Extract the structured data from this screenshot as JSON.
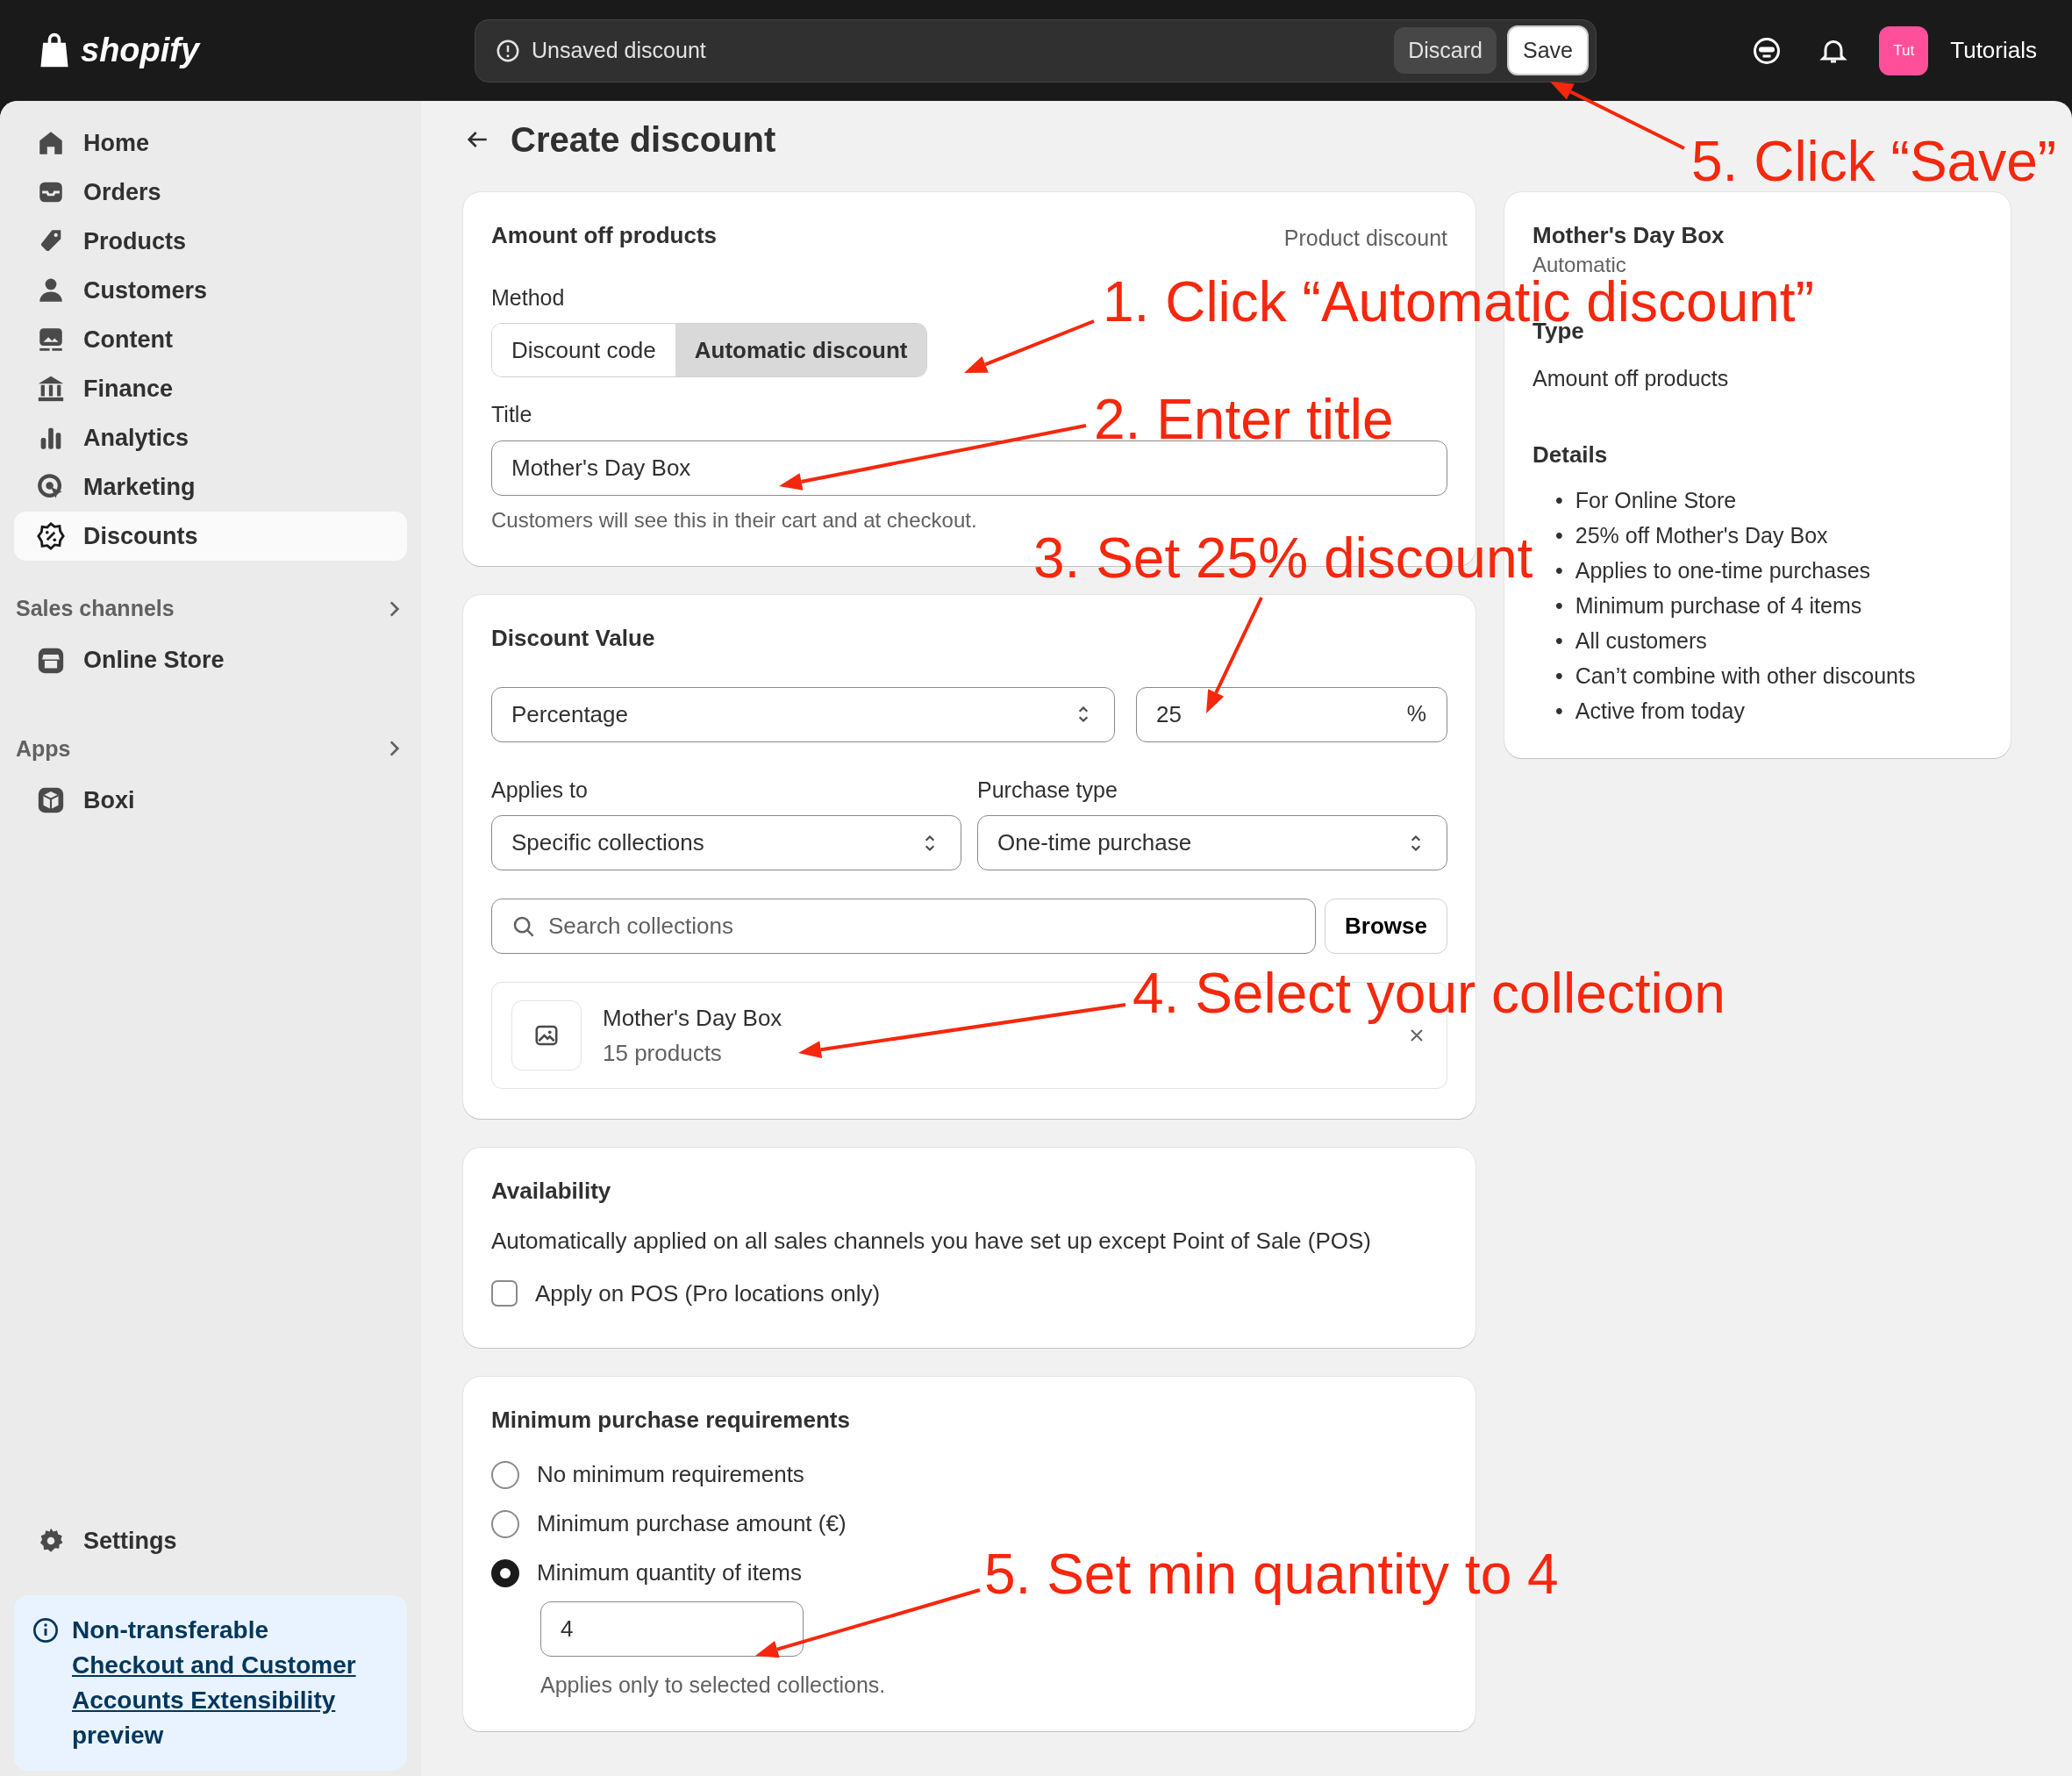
{
  "topbar": {
    "logo": "shopify",
    "save_bar": {
      "message": "Unsaved discount",
      "buttons": [
        {
          "label": "Discard",
          "kind": "secondary"
        },
        {
          "label": "Save",
          "kind": "primary"
        }
      ]
    },
    "avatar": "Tut",
    "store": "Tutorials"
  },
  "sidebar": {
    "items": [
      {
        "label": "Home",
        "selected": false
      },
      {
        "label": "Orders",
        "selected": false
      },
      {
        "label": "Products",
        "selected": false
      },
      {
        "label": "Customers",
        "selected": false
      },
      {
        "label": "Content",
        "selected": false
      },
      {
        "label": "Finance",
        "selected": false
      },
      {
        "label": "Analytics",
        "selected": false
      },
      {
        "label": "Marketing",
        "selected": false
      },
      {
        "label": "Discounts",
        "selected": true
      }
    ],
    "sections": [
      {
        "title": "Sales channels",
        "items": [
          {
            "label": "Online Store"
          }
        ]
      },
      {
        "title": "Apps",
        "items": [
          {
            "label": "Boxi"
          }
        ]
      }
    ],
    "settings": "Settings",
    "notice": {
      "text": "Non-transferable",
      "link_lines": [
        "Checkout and Customer",
        "Accounts Extensibility"
      ],
      "suffix": "preview"
    }
  },
  "page": {
    "title": "Create discount"
  },
  "amount_card": {
    "title": "Amount off products",
    "type": "Product discount",
    "method_label": "Method",
    "methods": [
      {
        "label": "Discount code",
        "selected": false
      },
      {
        "label": "Automatic discount",
        "selected": true
      }
    ],
    "title_label": "Title",
    "title_value": "Mother's Day Box",
    "help": "Customers will see this in their cart and at checkout."
  },
  "value_card": {
    "title": "Discount Value",
    "value_type": "Percentage",
    "value": "25",
    "suffix": "%",
    "applies_label": "Applies to",
    "applies_value": "Specific collections",
    "purchase_label": "Purchase type",
    "purchase_value": "One-time purchase",
    "search_placeholder": "Search collections",
    "browse": "Browse",
    "collections": [
      {
        "name": "Mother's Day Box",
        "count": "15 products"
      }
    ]
  },
  "availability_card": {
    "title": "Availability",
    "text": "Automatically applied on all sales channels you have set up except Point of Sale (POS)",
    "pos": {
      "label": "Apply on POS (Pro locations only)",
      "checked": false
    }
  },
  "minimum_card": {
    "title": "Minimum purchase requirements",
    "options": [
      {
        "label": "No minimum requirements",
        "selected": false
      },
      {
        "label": "Minimum purchase amount (€)",
        "selected": false
      },
      {
        "label": "Minimum quantity of items",
        "selected": true
      }
    ],
    "quantity": "4",
    "note": "Applies only to selected collections."
  },
  "summary": {
    "title": "Mother's Day Box",
    "subtitle": "Automatic",
    "type_label": "Type",
    "type_value": "Amount off products",
    "details_label": "Details",
    "bullet": "•",
    "details": [
      "For Online Store",
      "25% off Mother's Day Box",
      "Applies to one-time purchases",
      "Minimum purchase of 4 items",
      "All customers",
      "Can’t combine with other discounts",
      "Active from today"
    ]
  },
  "annotations": [
    "1. Click “Automatic discount”",
    "2. Enter title",
    "3. Set 25% discount",
    "4. Select your collection",
    "5. Set min quantity to 4",
    "5. Click “Save”"
  ]
}
